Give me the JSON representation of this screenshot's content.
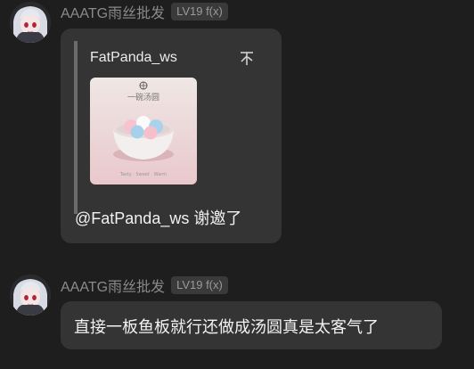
{
  "messages": [
    {
      "sender": "AAATG雨丝批发",
      "level_badge": "LV19 f(x)",
      "quote": {
        "author": "FatPanda_ws",
        "image_caption": "一碗汤圆",
        "image_bottom_text": "Tasty · Sweet · Warm"
      },
      "text": "@FatPanda_ws 谢邀了"
    },
    {
      "sender": "AAATG雨丝批发",
      "level_badge": "LV19 f(x)",
      "text": "直接一板鱼板就行还做成汤圆真是太客气了"
    }
  ],
  "icons": {
    "avatar": "anime-avatar-icon",
    "quote_action": "collapse-quote-icon"
  },
  "colors": {
    "background": "#1e1e1e",
    "bubble": "#343434",
    "sender_text": "#8a8a8a",
    "badge_bg": "#3a3a3a",
    "quote_bar": "#6b6b6b"
  }
}
